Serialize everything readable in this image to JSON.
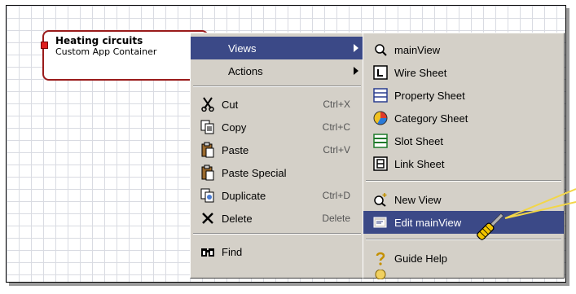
{
  "node": {
    "title": "Heating circuits",
    "subtitle": "Custom App Container"
  },
  "context_menu": {
    "views_label": "Views",
    "actions_label": "Actions",
    "items": [
      {
        "label": "Cut",
        "shortcut": "Ctrl+X",
        "icon": "scissors-icon"
      },
      {
        "label": "Copy",
        "shortcut": "Ctrl+C",
        "icon": "copy-icon"
      },
      {
        "label": "Paste",
        "shortcut": "Ctrl+V",
        "icon": "paste-icon"
      },
      {
        "label": "Paste Special",
        "shortcut": "",
        "icon": "paste-special-icon"
      },
      {
        "label": "Duplicate",
        "shortcut": "Ctrl+D",
        "icon": "duplicate-icon"
      },
      {
        "label": "Delete",
        "shortcut": "Delete",
        "icon": "delete-icon"
      }
    ],
    "find_label": "Find"
  },
  "views_submenu": {
    "items": [
      {
        "label": "mainView",
        "icon": "magnifier-view-icon"
      },
      {
        "label": "Wire Sheet",
        "icon": "wire-sheet-icon"
      },
      {
        "label": "Property Sheet",
        "icon": "property-sheet-icon"
      },
      {
        "label": "Category Sheet",
        "icon": "category-sheet-icon"
      },
      {
        "label": "Slot Sheet",
        "icon": "slot-sheet-icon"
      },
      {
        "label": "Link Sheet",
        "icon": "link-sheet-icon"
      }
    ],
    "new_view_label": "New View",
    "edit_view_label": "Edit mainView",
    "guide_help_label": "Guide Help"
  },
  "colors": {
    "highlight": "#3b4987",
    "node_border": "#9a1b1b",
    "menu_bg": "#d4d0c8",
    "callout": "#f2d648"
  }
}
